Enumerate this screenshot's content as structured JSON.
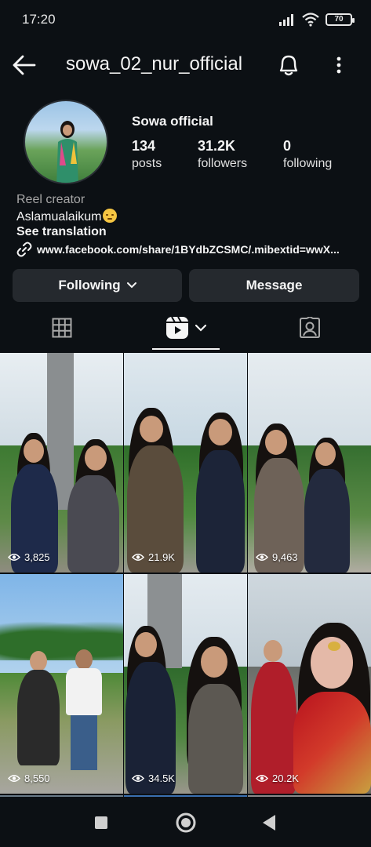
{
  "status_bar": {
    "time": "17:20",
    "battery": "70"
  },
  "header": {
    "username": "sowa_02_nur_official"
  },
  "profile": {
    "display_name": "Sowa official",
    "stats": [
      {
        "value": "134",
        "label": "posts"
      },
      {
        "value": "31.2K",
        "label": "followers"
      },
      {
        "value": "0",
        "label": "following"
      }
    ],
    "category": "Reel creator",
    "bio": "Aslamualaikum",
    "see_translation": "See translation",
    "link": "www.facebook.com/share/1BYdbZCSMC/.mibextid=wwX..."
  },
  "actions": {
    "following_label": "Following",
    "message_label": "Message"
  },
  "tabs": {
    "active": "reels"
  },
  "reels": [
    {
      "views": "3,825"
    },
    {
      "views": "21.9K"
    },
    {
      "views": "9,463"
    },
    {
      "views": "8,550"
    },
    {
      "views": "34.5K"
    },
    {
      "views": "20.2K"
    }
  ],
  "colors": {
    "background": "#0c1014",
    "button": "#25292e",
    "text": "#f5f5f5",
    "muted": "#a8a8a8"
  }
}
